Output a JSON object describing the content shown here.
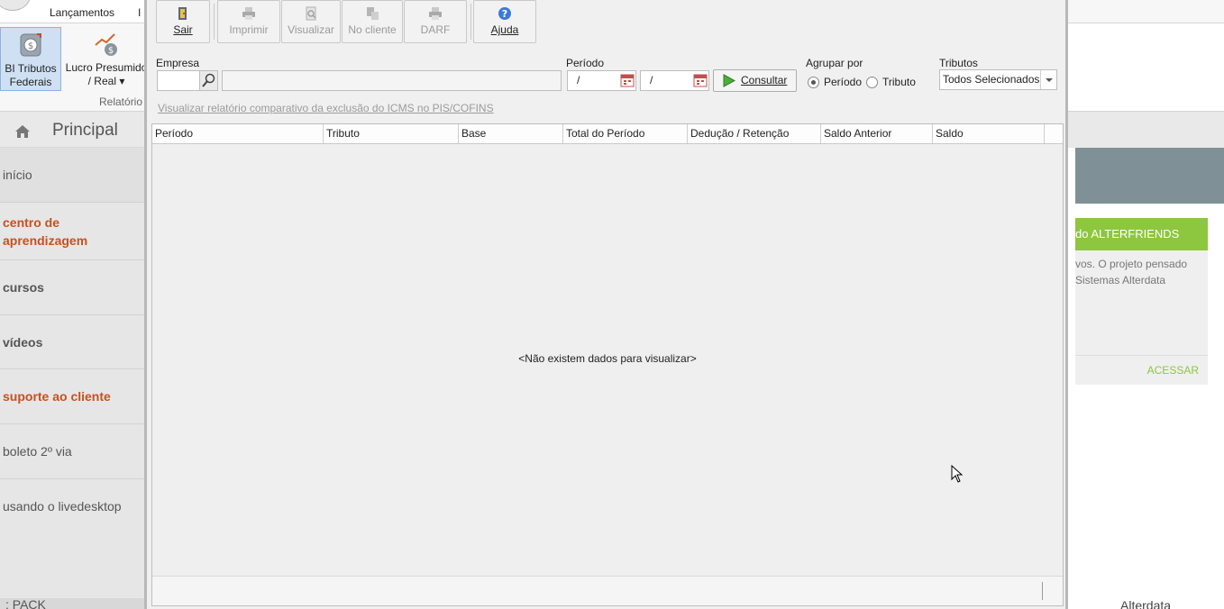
{
  "background_left": {
    "ribbon_tabs": [
      "Lançamentos",
      "I"
    ],
    "ribbon_buttons": [
      {
        "label_line1": "BI Tributos",
        "label_line2": "Federais"
      },
      {
        "label_line1": "Lucro Presumido",
        "label_line2": "/ Real ▾"
      }
    ],
    "ribbon_group_label": "Relatório",
    "sidebar": {
      "title": "Principal",
      "items": [
        {
          "label": "início",
          "style": "normal"
        },
        {
          "label": "centro de aprendizagem",
          "style": "orange"
        },
        {
          "label": "cursos",
          "style": "bold"
        },
        {
          "label": "vídeos",
          "style": "bold"
        },
        {
          "label": "suporte ao cliente",
          "style": "orange"
        },
        {
          "label": "boleto 2º via",
          "style": "normal"
        },
        {
          "label": "usando o livedesktop",
          "style": "normal"
        }
      ],
      "footer": ": PACK"
    }
  },
  "background_right": {
    "card_title": "do ALTERFRIENDS",
    "card_text_1": "vos. O projeto pensado",
    "card_text_2": "Sistemas Alterdata",
    "card_link": "ACESSAR",
    "footer": "Alterdata"
  },
  "toolbar": {
    "buttons": [
      {
        "label": "Sair",
        "enabled": true,
        "icon": "door-exit-icon"
      },
      {
        "label": "Imprimir",
        "enabled": false,
        "icon": "printer-icon"
      },
      {
        "label": "Visualizar",
        "enabled": false,
        "icon": "preview-icon"
      },
      {
        "label": "No cliente",
        "enabled": false,
        "icon": "client-server-icon"
      },
      {
        "label": "DARF",
        "enabled": false,
        "icon": "printer-icon"
      },
      {
        "label": "Ajuda",
        "enabled": true,
        "icon": "help-icon"
      }
    ]
  },
  "filters": {
    "empresa_label": "Empresa",
    "empresa_code": "",
    "empresa_name": "",
    "periodo_label": "Período",
    "periodo_start": "/",
    "periodo_end": "/",
    "consultar_label": "Consultar",
    "agrupar_label": "Agrupar por",
    "agrupar_options": [
      "Período",
      "Tributo"
    ],
    "agrupar_selected": "Período",
    "tributos_label": "Tributos",
    "tributos_value": "Todos Selecionados",
    "report_link": "Visualizar relatório comparativo da exclusão do ICMS no PIS/COFINS"
  },
  "grid": {
    "columns": [
      "Período",
      "Tributo",
      "Base",
      "Total do Período",
      "Dedução / Retenção",
      "Saldo Anterior",
      "Saldo"
    ],
    "rows": [],
    "empty_message": "<Não existem dados para visualizar>"
  },
  "colors": {
    "accent_orange": "#c8501e",
    "alterfriends_green": "#8dc63f",
    "banner_gray": "#7f9196",
    "active_ribbon": "#cfe0f3"
  }
}
